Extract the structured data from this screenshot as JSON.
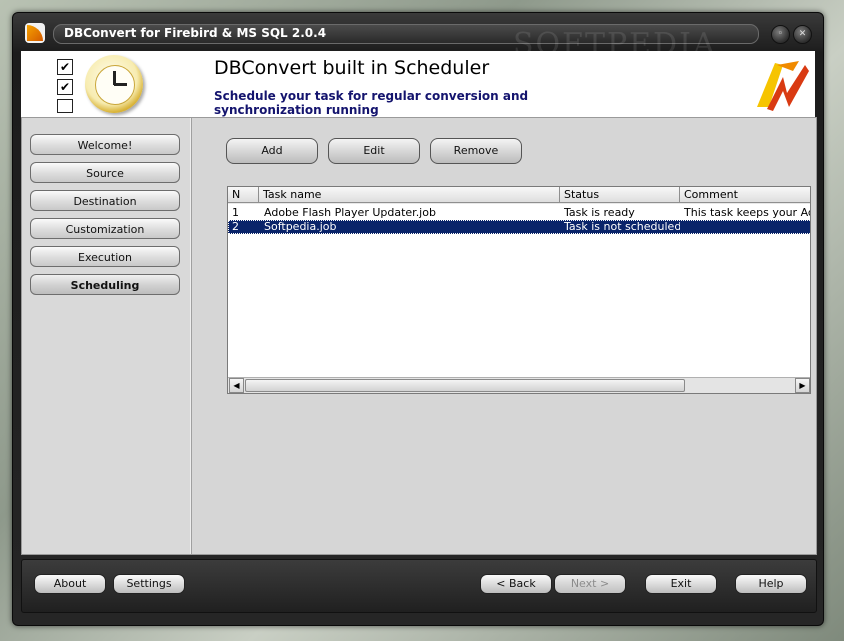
{
  "window": {
    "title": "DBConvert for Firebird & MS SQL 2.0.4",
    "minimize_glyph": "◦",
    "close_glyph": "✕",
    "watermark": "SOFTPEDIA"
  },
  "header": {
    "title": "DBConvert built in  Scheduler",
    "subtitle": "Schedule your task for regular conversion and synchronization running",
    "checkboxes": [
      "✔",
      "✔",
      ""
    ],
    "title_color": "#000000",
    "subtitle_color": "#14146e"
  },
  "sidebar": {
    "items": [
      {
        "label": "Welcome!"
      },
      {
        "label": "Source"
      },
      {
        "label": "Destination"
      },
      {
        "label": "Customization"
      },
      {
        "label": "Execution"
      },
      {
        "label": "Scheduling"
      }
    ],
    "active_index": 5
  },
  "toolbar": {
    "add_label": "Add",
    "edit_label": "Edit",
    "remove_label": "Remove"
  },
  "task_list": {
    "columns": [
      "N",
      "Task name",
      "Status",
      "Comment"
    ],
    "rows": [
      {
        "n": "1",
        "name": "Adobe Flash Player Updater.job",
        "status": "Task is ready",
        "comment": "This task keeps your Adobe"
      },
      {
        "n": "2",
        "name": "Softpedia.job",
        "status": "Task is not scheduled",
        "comment": ""
      }
    ],
    "selected_index": 1,
    "selection_color": "#0a246a",
    "scroll_left_glyph": "◀",
    "scroll_right_glyph": "▶"
  },
  "footer": {
    "about_label": "About",
    "settings_label": "Settings",
    "back_label": "< Back",
    "next_label": "Next >",
    "exit_label": "Exit",
    "help_label": "Help"
  },
  "icons": {
    "app": "dbconvert-app-icon",
    "header_clock": "clock-icon",
    "brand": "dbconvert-logo-icon"
  }
}
